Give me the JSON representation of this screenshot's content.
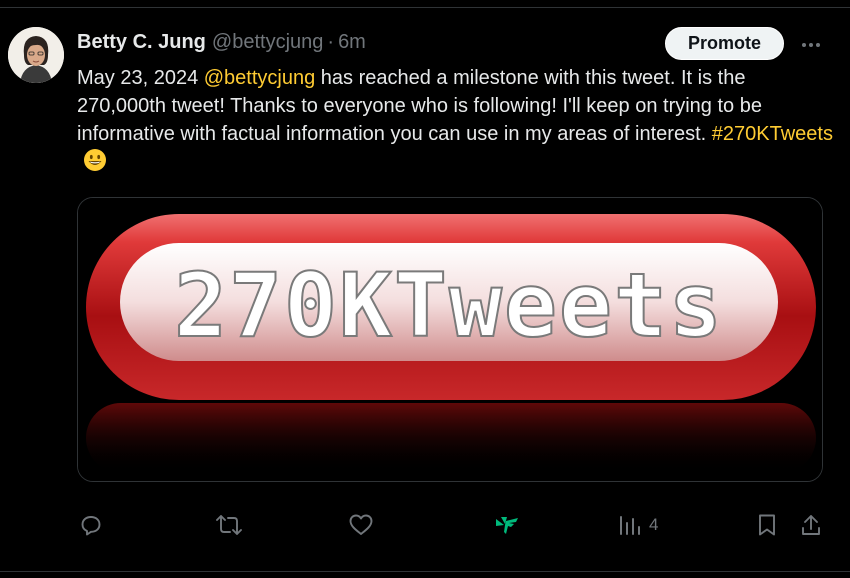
{
  "tweet": {
    "author_name": "Betty C. Jung",
    "author_handle": "@bettycjung",
    "separator": "·",
    "time_ago": "6m",
    "text_before": "May 23, 2024 ",
    "mention": "@bettycjung",
    "text_after": " has reached a milestone with this tweet. It is the 270,000th tweet! Thanks to everyone who is following! I'll keep on trying to be informative with factual information you can use in my areas of interest. ",
    "hashtag": "#270KTweets",
    "emoji": "grinning-face",
    "image_text": "270KTweets",
    "views_count": "4"
  },
  "buttons": {
    "promote_label": "Promote"
  },
  "colors": {
    "background": "#000000",
    "text": "#e7e9ea",
    "muted": "#71767b",
    "link": "#ffcc33",
    "accent_green": "#00ba7c",
    "banner_red": "#c41d1d"
  },
  "icons": {
    "more": "more-horizontal-icon",
    "reply": "reply-icon",
    "retweet": "retweet-icon",
    "like": "heart-icon",
    "grok": "grok-icon",
    "views": "analytics-icon",
    "bookmark": "bookmark-icon",
    "share": "share-icon"
  }
}
